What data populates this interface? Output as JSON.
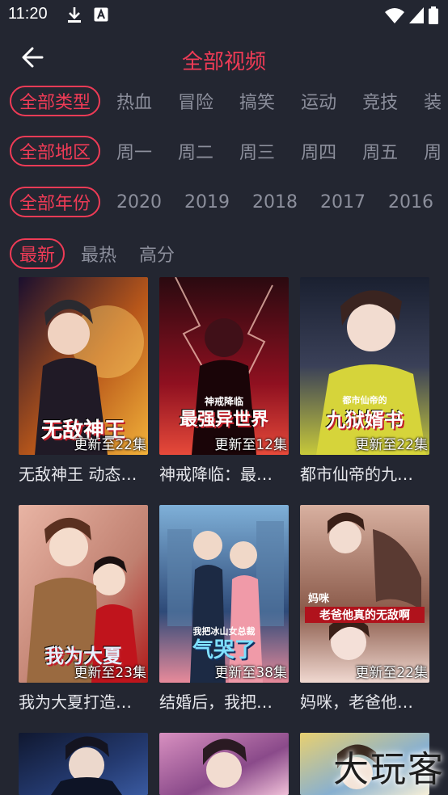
{
  "status_bar": {
    "time": "11:20"
  },
  "header": {
    "title": "全部视频"
  },
  "filters": {
    "type": [
      "全部类型",
      "热血",
      "冒险",
      "搞笑",
      "运动",
      "竞技",
      "装"
    ],
    "region": [
      "全部地区",
      "周一",
      "周二",
      "周三",
      "周四",
      "周五",
      "周"
    ],
    "year": [
      "全部年份",
      "2020",
      "2019",
      "2018",
      "2017",
      "2016"
    ],
    "sort": [
      "最新",
      "最热",
      "高分"
    ]
  },
  "cards": [
    {
      "title": "无敌神王 动态…",
      "episodes": "更新至22集",
      "cover_text": "无敌神王",
      "colors": [
        "#1a0f2e",
        "#b8571a",
        "#f2b23a"
      ]
    },
    {
      "title": "神戒降临：最…",
      "episodes": "更新至12集",
      "cover_text": "最强异世界",
      "cover_sub": "神戒降临",
      "colors": [
        "#2a0a10",
        "#8f1020",
        "#e64a3a"
      ]
    },
    {
      "title": "都市仙帝的九…",
      "episodes": "更新至22集",
      "cover_text": "九狱婿书",
      "cover_sub": "都市仙帝的",
      "colors": [
        "#1a2030",
        "#3a4058",
        "#c7c93a"
      ]
    },
    {
      "title": "我为大夏打造…",
      "episodes": "更新至23集",
      "cover_text": "我为大夏",
      "colors": [
        "#e8b4a4",
        "#c08070",
        "#b01818"
      ]
    },
    {
      "title": "结婚后，我把…",
      "episodes": "更新至38集",
      "cover_text": "气哭了",
      "cover_sub": "我把冰山女总裁",
      "colors": [
        "#7fb0d8",
        "#2e4a78",
        "#e88a9a"
      ]
    },
    {
      "title": "妈咪，老爸他…",
      "episodes": "更新至22集",
      "cover_text": "老爸他真的无敌啊",
      "cover_sub": "妈咪",
      "colors": [
        "#d8b0a0",
        "#8a5a4a",
        "#f0d8d0"
      ]
    },
    {
      "colors": [
        "#101830",
        "#243a70",
        "#3a5aa0"
      ]
    },
    {
      "colors": [
        "#d890c0",
        "#8a4a8a",
        "#f0c0d8"
      ]
    },
    {
      "colors": [
        "#e8d070",
        "#88b0d0",
        "#f8f0d8"
      ]
    }
  ],
  "watermark": "大玩客"
}
